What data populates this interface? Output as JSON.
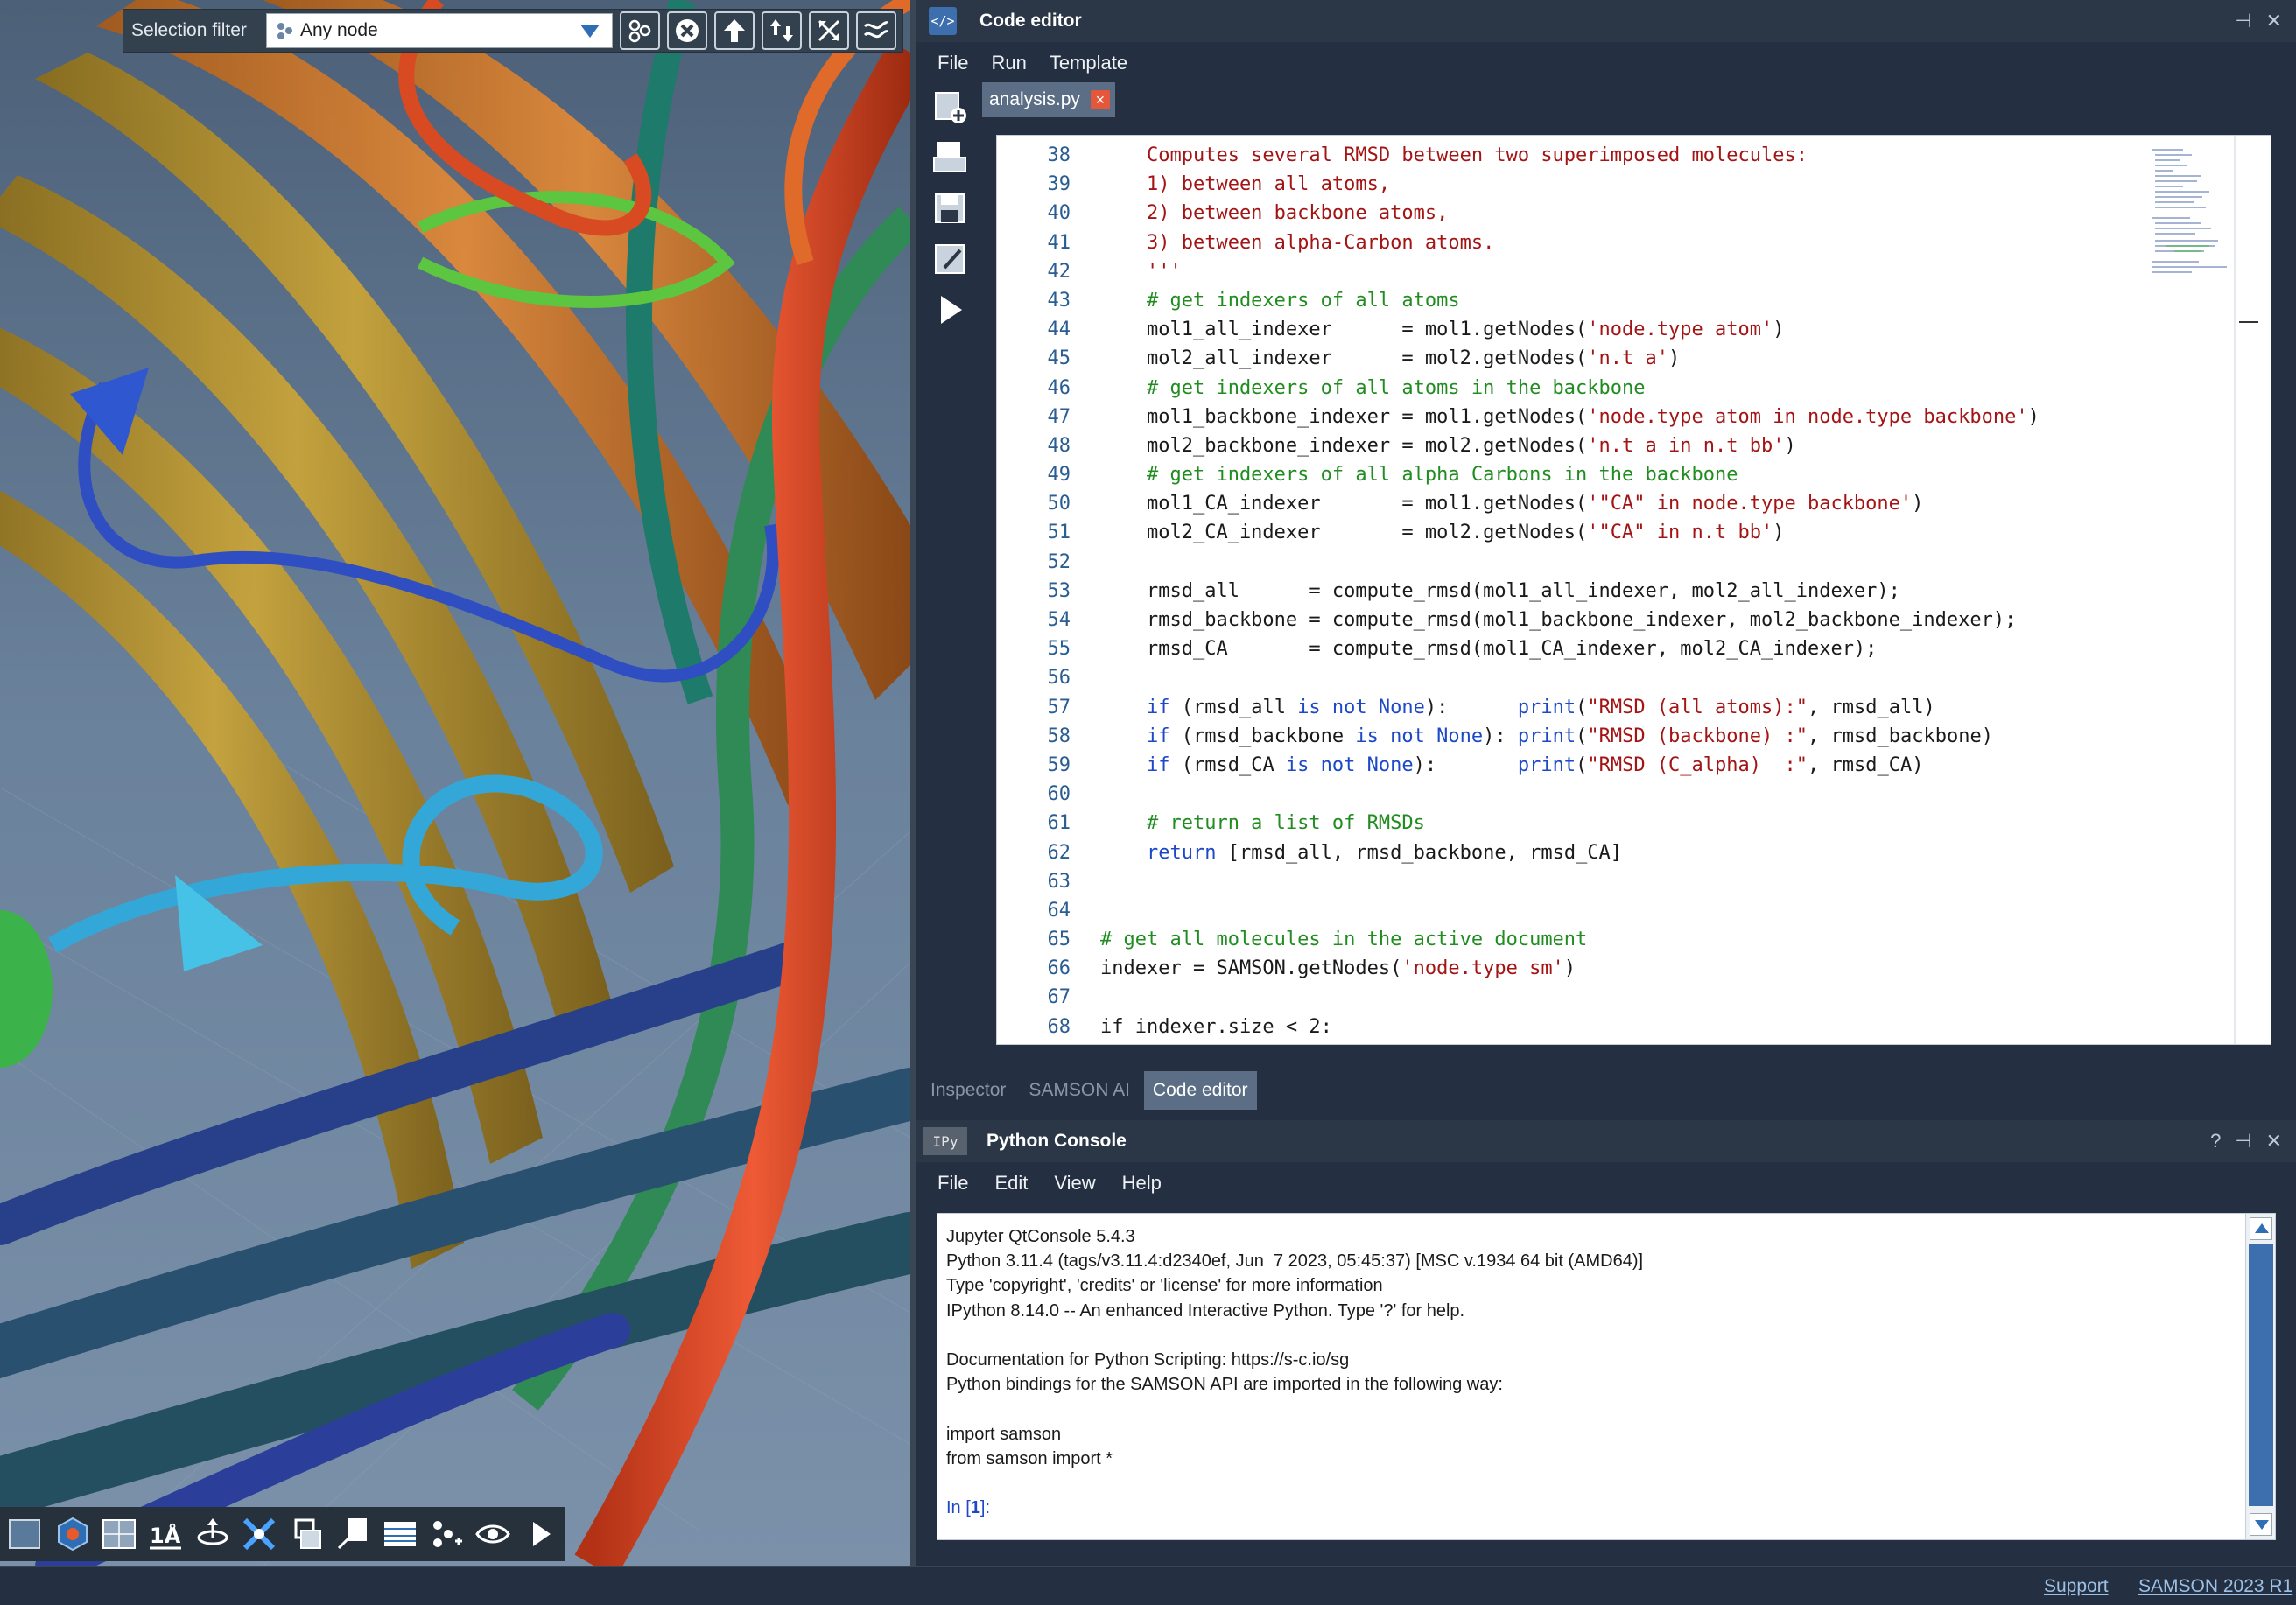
{
  "viewport": {
    "selection_filter": {
      "label": "Selection filter",
      "value": "Any node"
    },
    "filter_buttons": [
      "select-related-icon",
      "clear-selection-icon",
      "select-parent-icon",
      "expand-selection-icon",
      "shrink-selection-icon",
      "invert-selection-icon"
    ],
    "toolbar": [
      "select-tool-icon",
      "visual-model-icon",
      "floor-icon",
      "measure-distance-icon",
      "move-tool-icon",
      "rotate-tool-icon",
      "capture-icon",
      "note-icon",
      "panel-icon",
      "node-add-icon",
      "view-icon",
      "play-icon"
    ]
  },
  "code_editor": {
    "title": "Code editor",
    "menu": [
      "File",
      "Run",
      "Template"
    ],
    "tab": "analysis.py",
    "side_buttons": [
      "new-script-icon",
      "open-icon",
      "save-icon",
      "save-as-icon",
      "run-icon"
    ],
    "lines": [
      {
        "n": "38",
        "t": [
          {
            "s": "    Computes several RMSD between two superimposed molecules:",
            "c": "s"
          }
        ]
      },
      {
        "n": "39",
        "t": [
          {
            "s": "    1) between all atoms,",
            "c": "s"
          }
        ]
      },
      {
        "n": "40",
        "t": [
          {
            "s": "    2) between backbone atoms,",
            "c": "s"
          }
        ]
      },
      {
        "n": "41",
        "t": [
          {
            "s": "    3) between alpha-Carbon atoms.",
            "c": "s"
          }
        ]
      },
      {
        "n": "42",
        "t": [
          {
            "s": "    '''",
            "c": "s"
          }
        ]
      },
      {
        "n": "43",
        "t": [
          {
            "s": "    # get indexers of all atoms",
            "c": "c"
          }
        ]
      },
      {
        "n": "44",
        "t": [
          {
            "s": "    mol1_all_indexer      = mol1.getNodes(",
            "c": ""
          },
          {
            "s": "'node.type atom'",
            "c": "s"
          },
          {
            "s": ")",
            "c": ""
          }
        ]
      },
      {
        "n": "45",
        "t": [
          {
            "s": "    mol2_all_indexer      = mol2.getNodes(",
            "c": ""
          },
          {
            "s": "'n.t a'",
            "c": "s"
          },
          {
            "s": ")",
            "c": ""
          }
        ]
      },
      {
        "n": "46",
        "t": [
          {
            "s": "    # get indexers of all atoms in the backbone",
            "c": "c"
          }
        ]
      },
      {
        "n": "47",
        "t": [
          {
            "s": "    mol1_backbone_indexer = mol1.getNodes(",
            "c": ""
          },
          {
            "s": "'node.type atom in node.type backbone'",
            "c": "s"
          },
          {
            "s": ")",
            "c": ""
          }
        ]
      },
      {
        "n": "48",
        "t": [
          {
            "s": "    mol2_backbone_indexer = mol2.getNodes(",
            "c": ""
          },
          {
            "s": "'n.t a in n.t bb'",
            "c": "s"
          },
          {
            "s": ")",
            "c": ""
          }
        ]
      },
      {
        "n": "49",
        "t": [
          {
            "s": "    # get indexers of all alpha Carbons in the backbone",
            "c": "c"
          }
        ]
      },
      {
        "n": "50",
        "t": [
          {
            "s": "    mol1_CA_indexer       = mol1.getNodes(",
            "c": ""
          },
          {
            "s": "'\"CA\" in node.type backbone'",
            "c": "s"
          },
          {
            "s": ")",
            "c": ""
          }
        ]
      },
      {
        "n": "51",
        "t": [
          {
            "s": "    mol2_CA_indexer       = mol2.getNodes(",
            "c": ""
          },
          {
            "s": "'\"CA\" in n.t bb'",
            "c": "s"
          },
          {
            "s": ")",
            "c": ""
          }
        ]
      },
      {
        "n": "52",
        "t": [
          {
            "s": "",
            "c": ""
          }
        ]
      },
      {
        "n": "53",
        "t": [
          {
            "s": "    rmsd_all      = compute_rmsd(mol1_all_indexer, mol2_all_indexer);",
            "c": ""
          }
        ]
      },
      {
        "n": "54",
        "t": [
          {
            "s": "    rmsd_backbone = compute_rmsd(mol1_backbone_indexer, mol2_backbone_indexer);",
            "c": ""
          }
        ]
      },
      {
        "n": "55",
        "t": [
          {
            "s": "    rmsd_CA       = compute_rmsd(mol1_CA_indexer, mol2_CA_indexer);",
            "c": ""
          }
        ]
      },
      {
        "n": "56",
        "t": [
          {
            "s": "",
            "c": ""
          }
        ]
      },
      {
        "n": "57",
        "t": [
          {
            "s": "    ",
            "c": ""
          },
          {
            "s": "if",
            "c": "k"
          },
          {
            "s": " (rmsd_all ",
            "c": ""
          },
          {
            "s": "is not None",
            "c": "k"
          },
          {
            "s": "):      ",
            "c": ""
          },
          {
            "s": "print",
            "c": "k"
          },
          {
            "s": "(",
            "c": ""
          },
          {
            "s": "\"RMSD (all atoms):\"",
            "c": "s"
          },
          {
            "s": ", rmsd_all)",
            "c": ""
          }
        ]
      },
      {
        "n": "58",
        "t": [
          {
            "s": "    ",
            "c": ""
          },
          {
            "s": "if",
            "c": "k"
          },
          {
            "s": " (rmsd_backbone ",
            "c": ""
          },
          {
            "s": "is not None",
            "c": "k"
          },
          {
            "s": "): ",
            "c": ""
          },
          {
            "s": "print",
            "c": "k"
          },
          {
            "s": "(",
            "c": ""
          },
          {
            "s": "\"RMSD (backbone) :\"",
            "c": "s"
          },
          {
            "s": ", rmsd_backbone)",
            "c": ""
          }
        ]
      },
      {
        "n": "59",
        "t": [
          {
            "s": "    ",
            "c": ""
          },
          {
            "s": "if",
            "c": "k"
          },
          {
            "s": " (rmsd_CA ",
            "c": ""
          },
          {
            "s": "is not None",
            "c": "k"
          },
          {
            "s": "):       ",
            "c": ""
          },
          {
            "s": "print",
            "c": "k"
          },
          {
            "s": "(",
            "c": ""
          },
          {
            "s": "\"RMSD (C_alpha)  :\"",
            "c": "s"
          },
          {
            "s": ", rmsd_CA)",
            "c": ""
          }
        ]
      },
      {
        "n": "60",
        "t": [
          {
            "s": "",
            "c": ""
          }
        ]
      },
      {
        "n": "61",
        "t": [
          {
            "s": "    # return a list of RMSDs",
            "c": "c"
          }
        ]
      },
      {
        "n": "62",
        "t": [
          {
            "s": "    ",
            "c": ""
          },
          {
            "s": "return",
            "c": "k"
          },
          {
            "s": " [rmsd_all, rmsd_backbone, rmsd_CA]",
            "c": ""
          }
        ]
      },
      {
        "n": "63",
        "t": [
          {
            "s": "",
            "c": ""
          }
        ]
      },
      {
        "n": "64",
        "t": [
          {
            "s": "",
            "c": ""
          }
        ]
      },
      {
        "n": "65",
        "t": [
          {
            "s": "# get all molecules in the active document",
            "c": "c"
          }
        ]
      },
      {
        "n": "66",
        "t": [
          {
            "s": "indexer = SAMSON.getNodes(",
            "c": ""
          },
          {
            "s": "'node.type sm'",
            "c": "s"
          },
          {
            "s": ")",
            "c": ""
          }
        ]
      },
      {
        "n": "67",
        "t": [
          {
            "s": "",
            "c": ""
          }
        ]
      },
      {
        "n": "68",
        "t": [
          {
            "s": "if indexer.size < 2:",
            "c": ""
          }
        ]
      }
    ]
  },
  "dock_tabs": [
    {
      "label": "Inspector",
      "active": false
    },
    {
      "label": "SAMSON AI",
      "active": false
    },
    {
      "label": "Code editor",
      "active": true
    }
  ],
  "python_console": {
    "title": "Python Console",
    "icon_label": "IPy",
    "help_label": "?",
    "menu": [
      "File",
      "Edit",
      "View",
      "Help"
    ],
    "lines": [
      "Jupyter QtConsole 5.4.3",
      "Python 3.11.4 (tags/v3.11.4:d2340ef, Jun  7 2023, 05:45:37) [MSC v.1934 64 bit (AMD64)]",
      "Type 'copyright', 'credits' or 'license' for more information",
      "IPython 8.14.0 -- An enhanced Interactive Python. Type '?' for help.",
      "",
      "Documentation for Python Scripting: https://s-c.io/sg",
      "Python bindings for the SAMSON API are imported in the following way:",
      "",
      "import samson",
      "from samson import *",
      ""
    ],
    "prompt": {
      "prefix": "In [",
      "number": "1",
      "suffix": "]:"
    }
  },
  "status": {
    "support": "Support",
    "version": "SAMSON 2023 R1"
  },
  "colors": {
    "accent": "#3d6fae",
    "panel": "#2b3746",
    "background": "#243041",
    "tab_active": "#5b6e85"
  }
}
